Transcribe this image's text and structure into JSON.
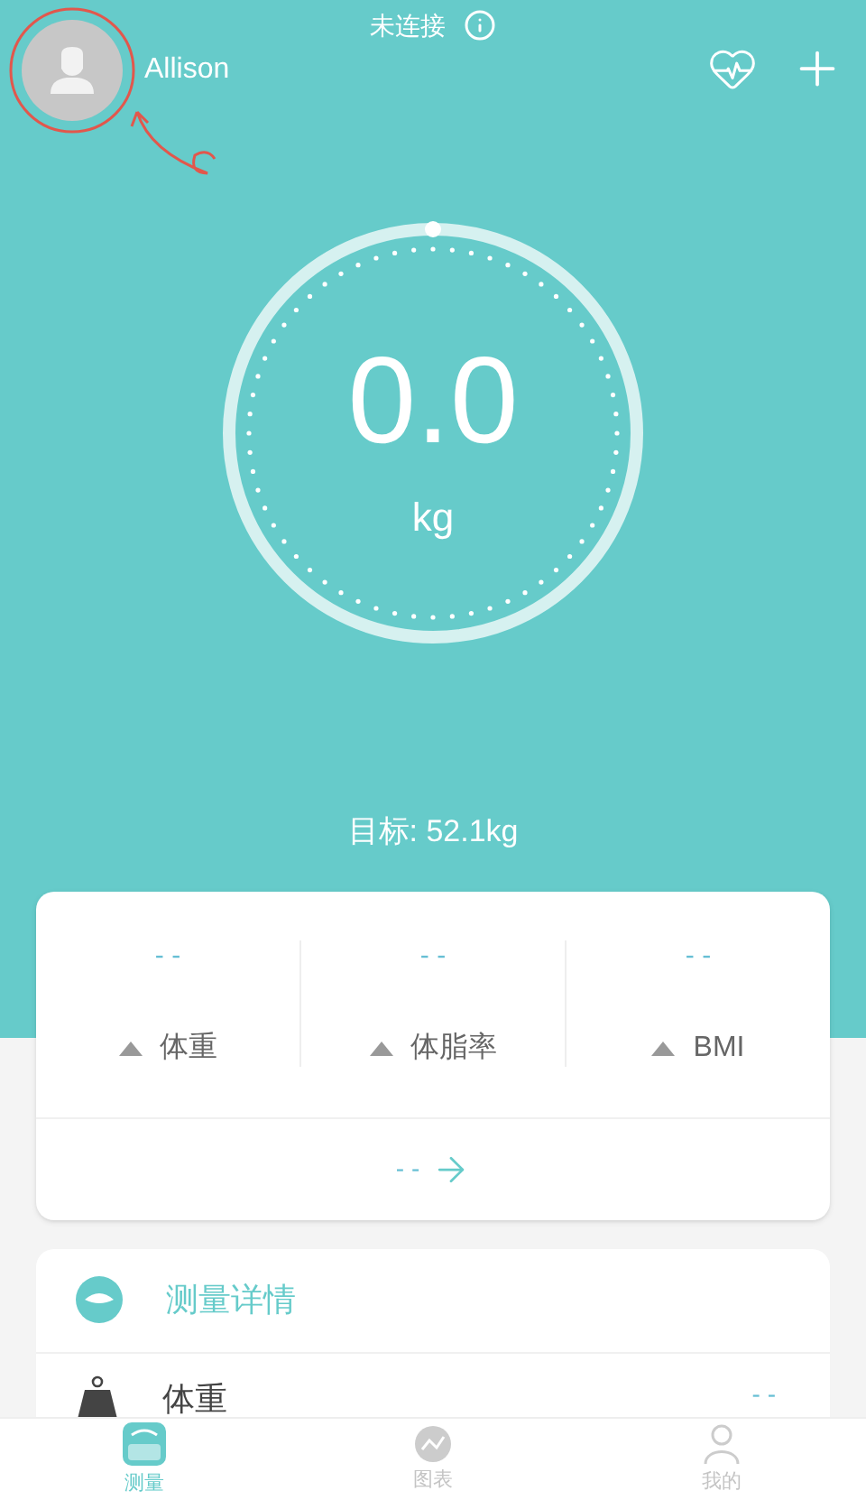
{
  "connection": {
    "status": "未连接"
  },
  "user": {
    "name": "Allison"
  },
  "gauge": {
    "value": "0.0",
    "unit": "kg"
  },
  "target": "目标: 52.1kg",
  "stats": [
    {
      "value": "- -",
      "label": "体重"
    },
    {
      "value": "- -",
      "label": "体脂率"
    },
    {
      "value": "- -",
      "label": "BMI"
    }
  ],
  "stats_footer": "- -",
  "details": {
    "title": "测量详情",
    "rows": [
      {
        "label": "体重",
        "value": "- -"
      }
    ]
  },
  "tabs": [
    {
      "label": "测量",
      "selected": true
    },
    {
      "label": "图表",
      "selected": false
    },
    {
      "label": "我的",
      "selected": false
    }
  ]
}
